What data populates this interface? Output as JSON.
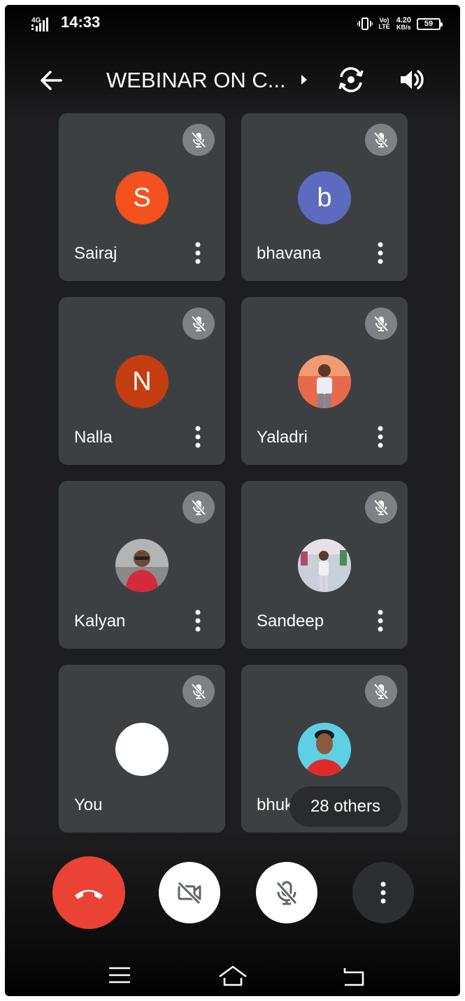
{
  "status_bar": {
    "network": "4G",
    "time": "14:33",
    "volte": "Vo) LTE",
    "speed_value": "4.20",
    "speed_unit": "KB/s",
    "battery": "59"
  },
  "header": {
    "title": "WEBINAR ON C..."
  },
  "participants": [
    {
      "name": "Sairaj",
      "initial": "S",
      "avatar_color": "#f4511e",
      "avatar_type": "initial"
    },
    {
      "name": "bhavana",
      "initial": "b",
      "avatar_color": "#5c6bc0",
      "avatar_type": "initial"
    },
    {
      "name": "Nalla",
      "initial": "N",
      "avatar_color": "#c43e12",
      "avatar_type": "initial"
    },
    {
      "name": "Yaladri",
      "initial": "",
      "avatar_color": "#e86a4a",
      "avatar_type": "photo"
    },
    {
      "name": "Kalyan",
      "initial": "",
      "avatar_color": "#6d6d6d",
      "avatar_type": "photo"
    },
    {
      "name": "Sandeep",
      "initial": "",
      "avatar_color": "#b8c2cf",
      "avatar_type": "photo"
    },
    {
      "name": "You",
      "initial": "",
      "avatar_color": "#ffffff",
      "avatar_type": "blank"
    },
    {
      "name": "bhuky",
      "initial": "",
      "avatar_color": "#4fc3d9",
      "avatar_type": "photo"
    }
  ],
  "others_chip": "28 others",
  "colors": {
    "tile_bg": "#3c4043",
    "hangup": "#ea4335",
    "mute_badge": "#7e8286"
  },
  "icons": {
    "back": "arrow-left-icon",
    "title_more": "caret-right-icon",
    "flip_camera": "flip-camera-icon",
    "speaker": "speaker-icon",
    "muted": "mic-off-icon",
    "participant_menu": "kebab-icon",
    "hangup": "phone-hangup-icon",
    "camera_off": "video-off-icon",
    "mic_off": "mic-off-icon",
    "more_options": "kebab-icon"
  }
}
